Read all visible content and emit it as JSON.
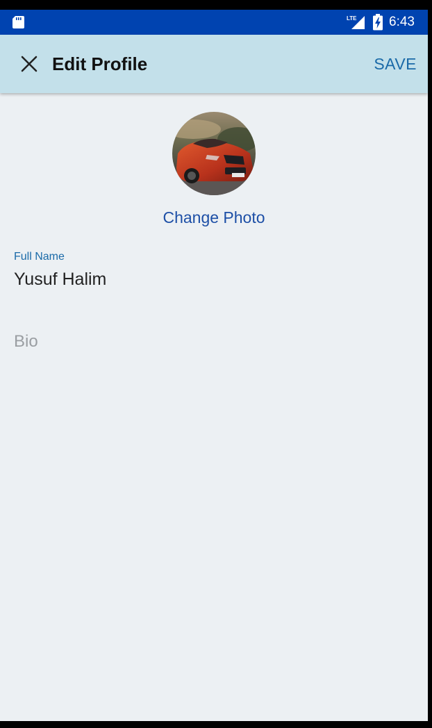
{
  "status_bar": {
    "network": "LTE",
    "time": "6:43",
    "icons": [
      "sd-card-icon",
      "signal-icon",
      "battery-charging-icon"
    ],
    "background_color": "#0043b0"
  },
  "app_bar": {
    "close_icon": "close-icon",
    "title": "Edit Profile",
    "save_label": "SAVE",
    "background_color": "#c3e0ea",
    "accent_color": "#1a6aa8"
  },
  "profile": {
    "change_photo_label": "Change Photo",
    "full_name_label": "Full Name",
    "full_name_value": "Yusuf Halim",
    "bio_placeholder": "Bio"
  }
}
